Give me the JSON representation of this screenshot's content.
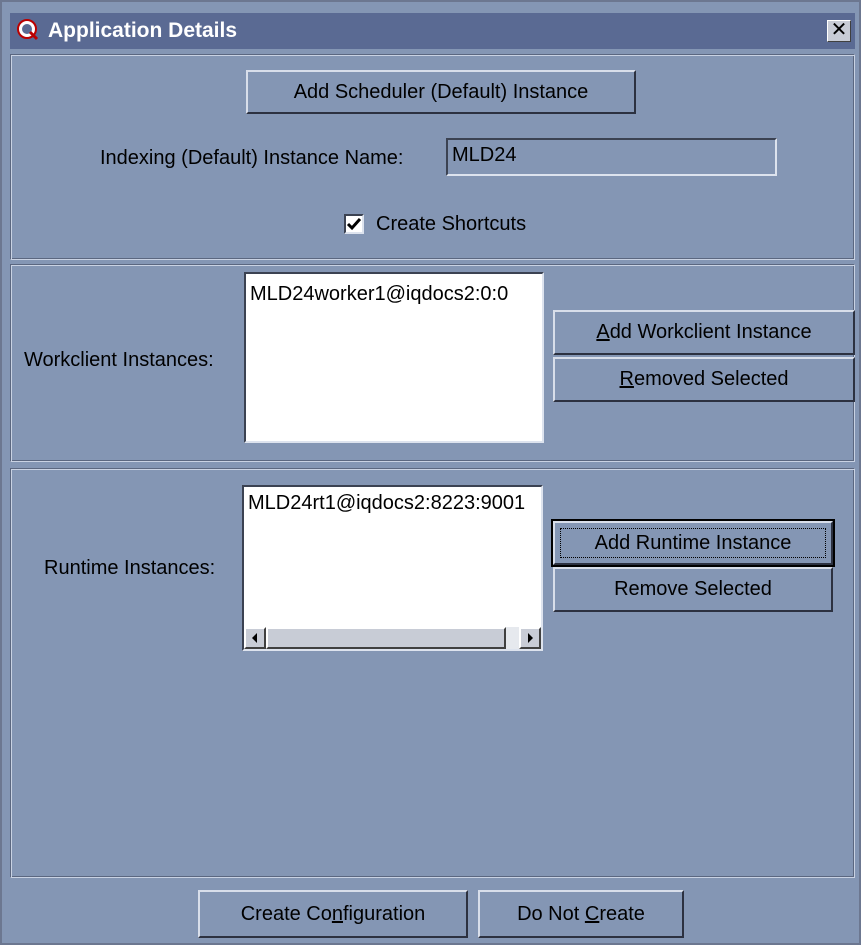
{
  "window": {
    "title": "Application Details",
    "close_glyph": "✕"
  },
  "top": {
    "add_scheduler_label": "Add Scheduler (Default) Instance",
    "indexing_label": "Indexing (Default) Instance Name:",
    "indexing_value": "MLD24",
    "create_shortcuts_label": "Create Shortcuts",
    "create_shortcuts_checked": true
  },
  "workclient": {
    "label": "Workclient Instances:",
    "items": [
      "MLD24worker1@iqdocs2:0:0"
    ],
    "add_button": {
      "mnemonic": "A",
      "rest": "dd Workclient Instance"
    },
    "remove_button": {
      "mnemonic": "R",
      "rest": "emoved Selected"
    }
  },
  "runtime": {
    "label": "Runtime Instances:",
    "items": [
      "MLD24rt1@iqdocs2:8223:9001"
    ],
    "add_button_label": "Add Runtime Instance",
    "remove_button_label": "Remove Selected"
  },
  "footer": {
    "create_config": {
      "before": "Create Co",
      "mnemonic": "n",
      "after": "figuration"
    },
    "do_not_create": {
      "before": "Do Not ",
      "mnemonic": "C",
      "after": "reate"
    }
  },
  "icons": {
    "title_icon": "magnifier-q-icon",
    "checkmark": "✔",
    "scroll_left": "◀",
    "scroll_right": "▶"
  }
}
